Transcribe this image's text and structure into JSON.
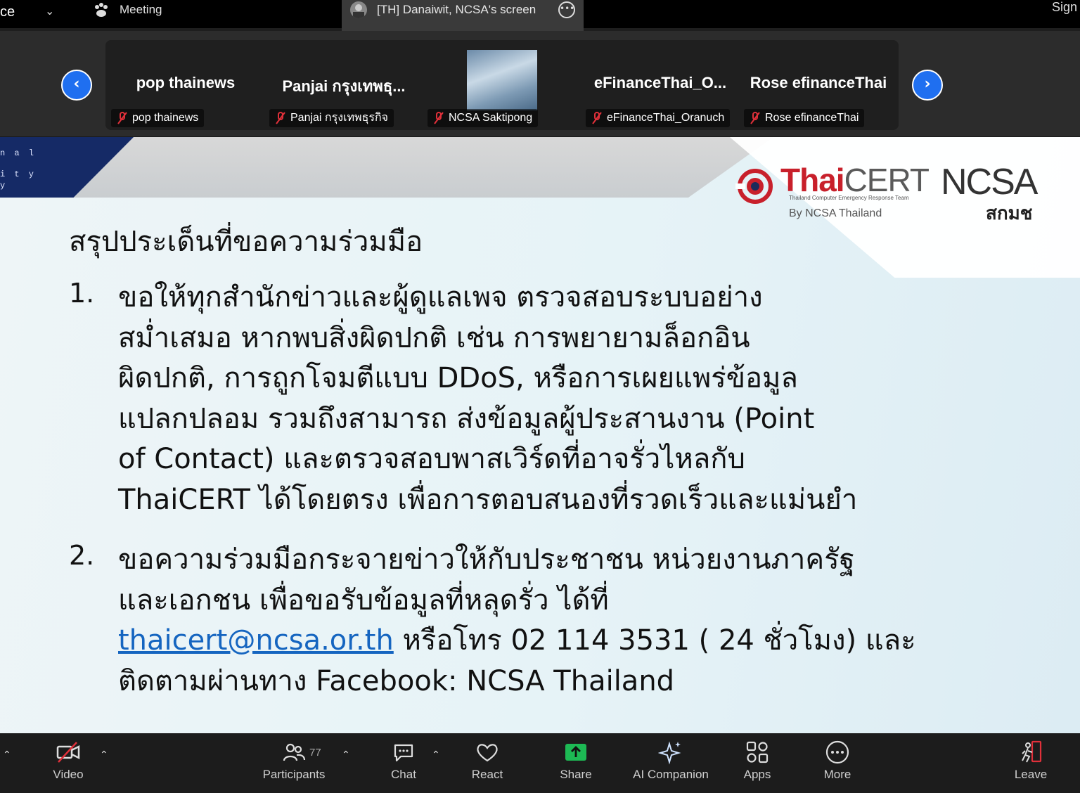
{
  "topbar": {
    "partial_title": "ce",
    "meeting_label": "Meeting",
    "screen_tab_label": "[TH] Danaiwit, NCSA's screen",
    "sign_partial": "Sign"
  },
  "participants": [
    {
      "display": "pop thainews",
      "label": "pop thainews"
    },
    {
      "display": "Panjai กรุงเทพธุ...",
      "label": "Panjai กรุงเทพธุรกิจ"
    },
    {
      "display": "",
      "label": "NCSA Saktipong"
    },
    {
      "display": "eFinanceThai_O...",
      "label": "eFinanceThai_Oranuch"
    },
    {
      "display": "Rose efinanceThai",
      "label": "Rose efinanceThai"
    }
  ],
  "slide": {
    "corner_lines": [
      "n a l",
      "i t y",
      "y"
    ],
    "logo": {
      "thai": "Thai",
      "cert": "CERT",
      "ncsa": "NCSA",
      "subtitle": "Thailand Computer Emergency Response Team",
      "by": "By NCSA Thailand",
      "thai_abbr": "สกมช"
    },
    "title": "สรุปประเด็นที่ขอความร่วมมือ",
    "item1": {
      "num": "1.",
      "lines": [
        "ขอให้ทุกสำนักข่าวและผู้ดูแลเพจ ตรวจสอบระบบอย่าง",
        "สม่ำเสมอ หากพบสิ่งผิดปกติ เช่น การพยายามล็อกอิน",
        "ผิดปกติ, การถูกโจมตีแบบ DDoS, หรือการเผยแพร่ข้อมูล",
        "แปลกปลอม รวมถึงสามารถ ส่งข้อมูลผู้ประสานงาน (Point",
        "of Contact) และตรวจสอบพาสเวิร์ดที่อาจรั่วไหลกับ",
        "ThaiCERT ได้โดยตรง เพื่อการตอบสนองที่รวดเร็วและแม่นยำ"
      ]
    },
    "item2": {
      "num": "2.",
      "line1": "ขอความร่วมมือกระจายข่าวให้กับประชาชน หน่วยงานภาครัฐ",
      "line2": "และเอกชน เพื่อขอรับข้อมูลที่หลุดรั่ว ได้ที่",
      "email": "thaicert@ncsa.or.th",
      "line3_rest": " หรือโทร 02 114 3531 ( 24 ชั่วโมง) และ",
      "line4": "ติดตามผ่านทาง Facebook: NCSA Thailand"
    }
  },
  "toolbar": {
    "video": "Video",
    "participants": "Participants",
    "participant_count": "77",
    "chat": "Chat",
    "react": "React",
    "share": "Share",
    "ai_companion": "AI Companion",
    "apps": "Apps",
    "more": "More",
    "leave": "Leave"
  },
  "colors": {
    "share_green": "#1db954",
    "nav_blue": "#1f6ff0",
    "link_blue": "#1565c0",
    "leave_red": "#e0303a",
    "thaicert_red": "#c8202b"
  }
}
